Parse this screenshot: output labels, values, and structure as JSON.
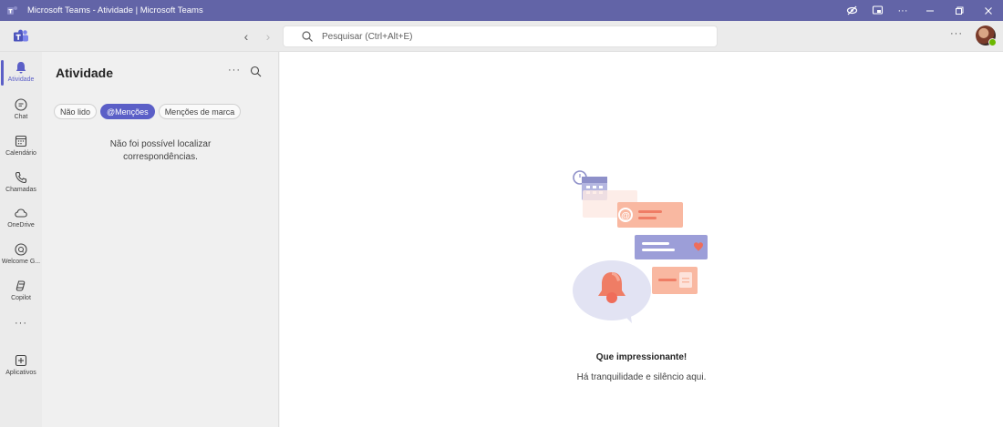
{
  "window": {
    "title": "Microsoft Teams - Atividade | Microsoft Teams"
  },
  "topbar": {
    "search_placeholder": "Pesquisar (Ctrl+Alt+E)"
  },
  "rail": {
    "items": [
      {
        "label": "Atividade",
        "icon": "bell-icon"
      },
      {
        "label": "Chat",
        "icon": "chat-icon"
      },
      {
        "label": "Calendário",
        "icon": "calendar-icon"
      },
      {
        "label": "Chamadas",
        "icon": "phone-icon"
      },
      {
        "label": "OneDrive",
        "icon": "cloud-icon"
      },
      {
        "label": "Welcome G...",
        "icon": "welcome-guide-icon"
      },
      {
        "label": "Copilot",
        "icon": "copilot-icon"
      },
      {
        "label": "Aplicativos",
        "icon": "add-apps-icon"
      }
    ]
  },
  "panel": {
    "title": "Atividade",
    "filters": [
      "Não lido",
      "@Menções",
      "Menções de marca"
    ],
    "active_filter": "@Menções",
    "empty_line1": "Não foi possível localizar",
    "empty_line2": "correspondências."
  },
  "main": {
    "title": "Que impressionante!",
    "subtitle": "Há tranquilidade e silêncio aqui."
  },
  "colors": {
    "brand": "#6264a7",
    "accent": "#5b5fc7",
    "presence": "#6bb700"
  }
}
